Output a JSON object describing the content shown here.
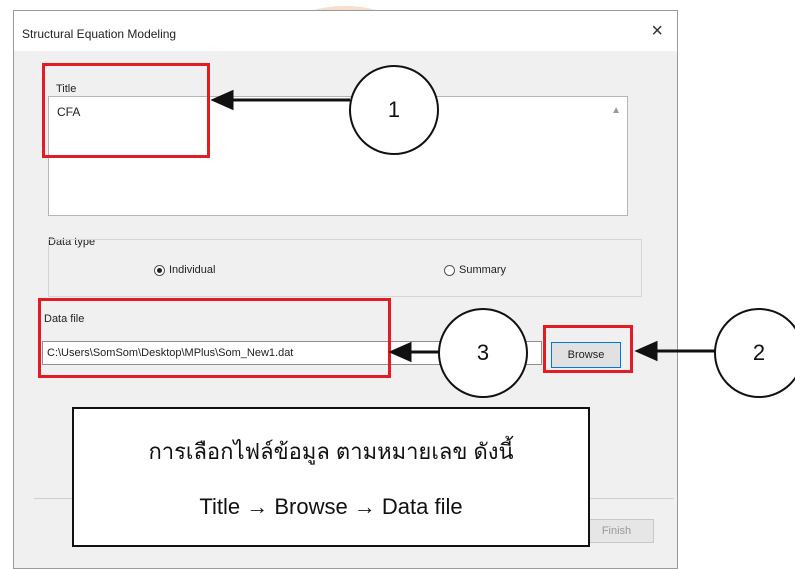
{
  "dialog": {
    "title": "Structural Equation Modeling",
    "close_glyph": "×"
  },
  "title_section": {
    "label": "Title",
    "value": "CFA"
  },
  "data_type": {
    "label": "Data type",
    "options": [
      {
        "label": "Individual",
        "selected": true
      },
      {
        "label": "Summary",
        "selected": false
      }
    ]
  },
  "data_file": {
    "label": "Data file",
    "value": "C:\\Users\\SomSom\\Desktop\\MPlus\\Som_New1.dat",
    "browse_label": "Browse"
  },
  "footer": {
    "finish_label": "Finish"
  },
  "annotations": {
    "markers": [
      "1",
      "2",
      "3"
    ],
    "callout_line1": "การเลือกไฟล์ข้อมูล ตามหมายเลข ดังนี้",
    "callout_line2": "Title → Browse → Data file",
    "highlight_color": "#e31b23"
  }
}
